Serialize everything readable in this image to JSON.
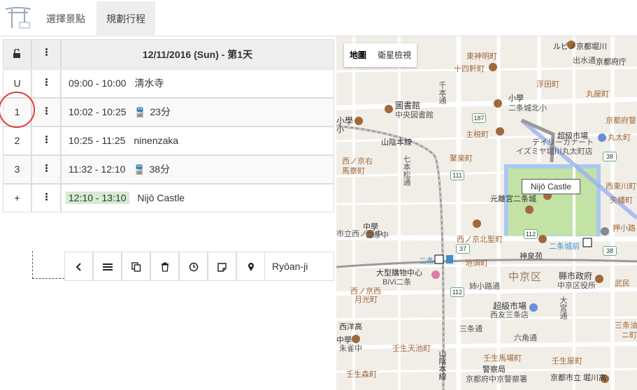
{
  "nav": {
    "tab_spots": "選擇景點",
    "tab_plan": "規劃行程"
  },
  "schedule": {
    "date_header": "12/11/2016 (Sun) - 第1天",
    "rows": [
      {
        "idx": "U",
        "time": "09:00 - 10:00",
        "label": "淸水寺",
        "kind": "place"
      },
      {
        "idx": "1",
        "time": "10:02 - 10:25",
        "label": "23分",
        "kind": "transit"
      },
      {
        "idx": "2",
        "time": "10:25 - 11:25",
        "label": "ninenzaka",
        "kind": "place"
      },
      {
        "idx": "3",
        "time": "11:32 - 12:10",
        "label": "38分",
        "kind": "transit"
      },
      {
        "idx": "+",
        "time": "12:10 - 13:10",
        "label": "Nijō Castle",
        "kind": "place",
        "highlight": true
      }
    ],
    "toolbar_field": "Ryōan-ji"
  },
  "map": {
    "type_map": "地圖",
    "type_satellite": "衛星檢視",
    "callout": "Nijō Castle",
    "labels": [
      {
        "t": "ルビノ京都堀川",
        "c": "dark"
      },
      {
        "t": "出水通",
        "c": "gray"
      },
      {
        "t": "京都府庁",
        "c": "dark"
      },
      {
        "t": "東神明町",
        "c": "brown"
      },
      {
        "t": "十四軒町",
        "c": "brown"
      },
      {
        "t": "小學",
        "c": "dark"
      },
      {
        "t": "二条城北小",
        "c": "gray"
      },
      {
        "t": "浮田町",
        "c": "brown"
      },
      {
        "t": "丸屋町",
        "c": "brown"
      },
      {
        "t": "京都府警",
        "c": "brown"
      },
      {
        "t": "丸太町",
        "c": "brown"
      },
      {
        "t": "圖書館",
        "c": "dark"
      },
      {
        "t": "中央図書館",
        "c": "gray"
      },
      {
        "t": "主税町",
        "c": "brown"
      },
      {
        "t": "超級市場",
        "c": "dark"
      },
      {
        "t": "デイリーカナート",
        "c": "gray"
      },
      {
        "t": "イズミヤ堀川丸太町店",
        "c": "gray"
      },
      {
        "t": "山陰本線",
        "c": "dark"
      },
      {
        "t": "西ノ京右",
        "c": "brown"
      },
      {
        "t": "馬寮町",
        "c": "brown"
      },
      {
        "t": "聚楽町",
        "c": "brown"
      },
      {
        "t": "元離宮二条城",
        "c": "dark"
      },
      {
        "t": "西東川町",
        "c": "brown"
      },
      {
        "t": "矢幡町",
        "c": "brown"
      },
      {
        "t": "中學",
        "c": "dark"
      },
      {
        "t": "二条中",
        "c": "gray"
      },
      {
        "t": "市立西ノ京中",
        "c": "gray"
      },
      {
        "t": "西ノ京北聖町",
        "c": "brown"
      },
      {
        "t": "二条城前",
        "c": "blue"
      },
      {
        "t": "押小路",
        "c": "brown"
      },
      {
        "t": "神泉苑",
        "c": "dark"
      },
      {
        "t": "二条",
        "c": "blue"
      },
      {
        "t": "池須町",
        "c": "brown"
      },
      {
        "t": "大型購物中心",
        "c": "dark"
      },
      {
        "t": "BiVi二条",
        "c": "gray"
      },
      {
        "t": "中京区",
        "c": "district"
      },
      {
        "t": "縣市政府",
        "c": "dark"
      },
      {
        "t": "中京区役所",
        "c": "gray"
      },
      {
        "t": "武民",
        "c": "brown"
      },
      {
        "t": "姉小路通",
        "c": "gray"
      },
      {
        "t": "西ノ京西",
        "c": "brown"
      },
      {
        "t": "月光町",
        "c": "brown"
      },
      {
        "t": "超級市場",
        "c": "dark"
      },
      {
        "t": "西友三条店",
        "c": "gray"
      },
      {
        "t": "西洋高",
        "c": "dark"
      },
      {
        "t": "中學",
        "c": "dark"
      },
      {
        "t": "朱雀中",
        "c": "gray"
      },
      {
        "t": "三条通",
        "c": "gray"
      },
      {
        "t": "六角通",
        "c": "gray"
      },
      {
        "t": "壬生天池町",
        "c": "brown"
      },
      {
        "t": "壬生馬場町",
        "c": "brown"
      },
      {
        "t": "壬生森町",
        "c": "brown"
      },
      {
        "t": "警察局",
        "c": "dark"
      },
      {
        "t": "京都府中京警察署",
        "c": "gray"
      },
      {
        "t": "壬生屋町",
        "c": "brown"
      },
      {
        "t": "京都市立 堀川高",
        "c": "dark"
      },
      {
        "t": "三条油",
        "c": "brown"
      },
      {
        "t": "ニ町",
        "c": "brown"
      },
      {
        "t": "大宮通",
        "c": "gray"
      },
      {
        "t": "千本通",
        "c": "gray"
      },
      {
        "t": "七本松通",
        "c": "gray"
      },
      {
        "t": "山陰本線",
        "c": "dark"
      },
      {
        "t": "小學",
        "c": "dark"
      },
      {
        "t": "小",
        "c": "dark"
      }
    ],
    "shields": [
      "187",
      "111",
      "112",
      "37",
      "38",
      "38",
      "112"
    ]
  }
}
